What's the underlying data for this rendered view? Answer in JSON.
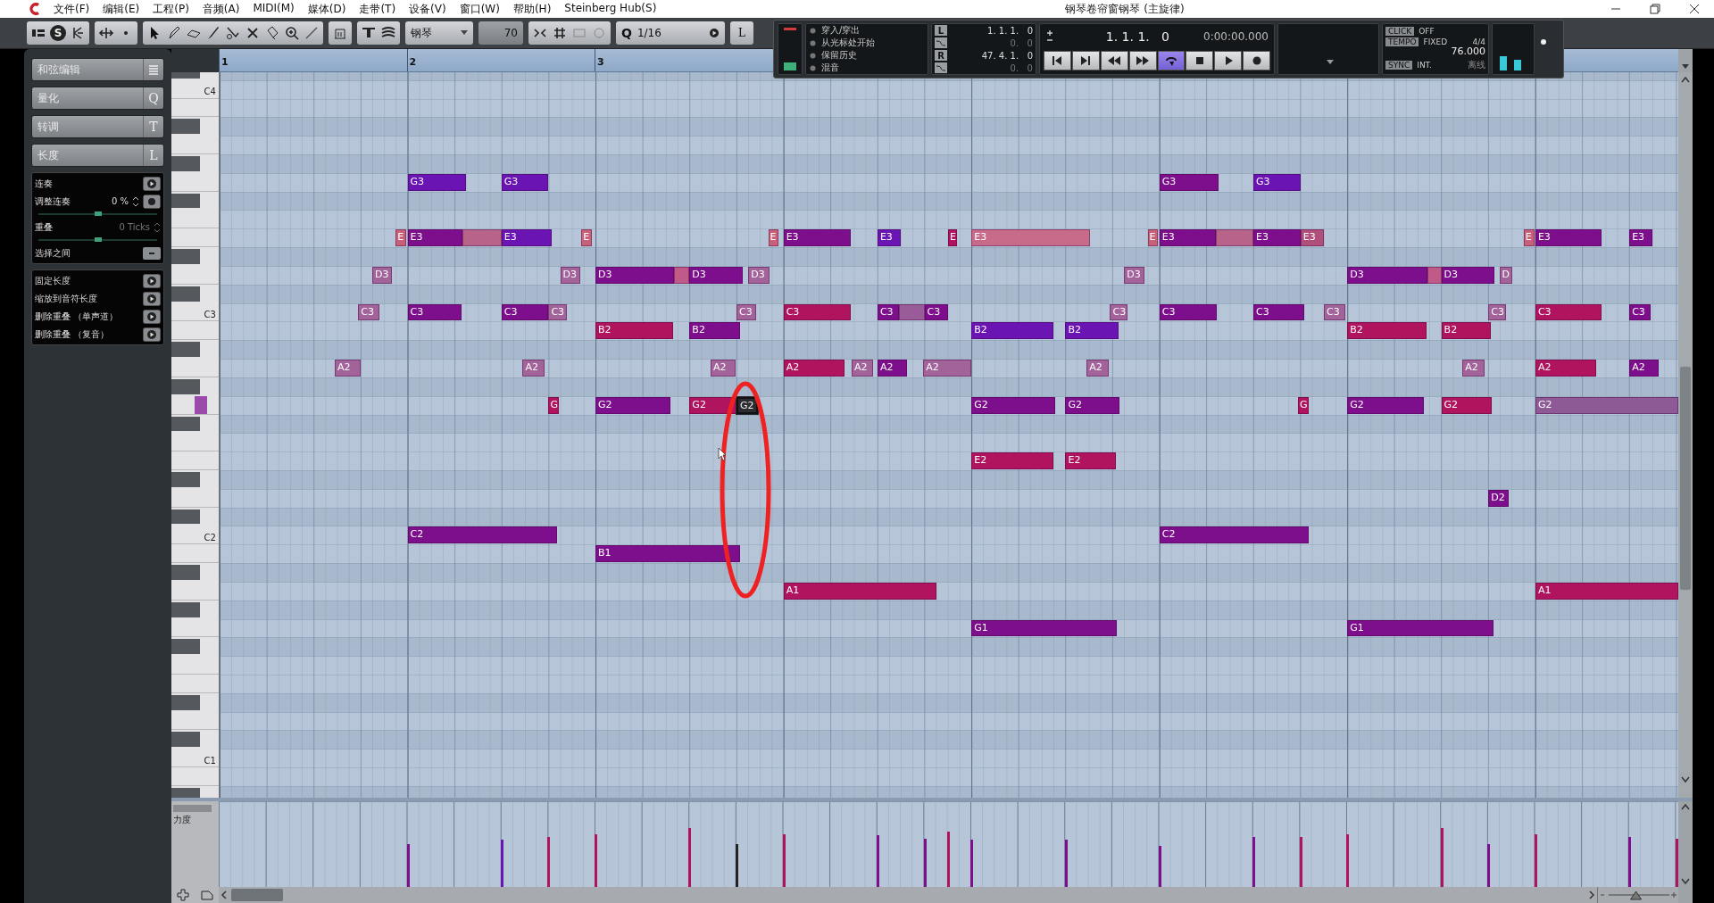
{
  "window": {
    "title": "钢琴卷帘窗钢琴 (主旋律)"
  },
  "menu": [
    "文件(F)",
    "编辑(E)",
    "工程(P)",
    "音频(A)",
    "MIDI(M)",
    "媒体(D)",
    "走带(T)",
    "设备(V)",
    "窗口(W)",
    "帮助(H)",
    "Steinberg Hub(S)"
  ],
  "toolbar": {
    "solo": "S",
    "instrument": "钢琴",
    "velocity": "70",
    "quantize_label": "Q",
    "quantize": "1/16",
    "length": "L"
  },
  "transport": {
    "modes": [
      {
        "label": "穿入/穿出"
      },
      {
        "label": "从光标处开始"
      },
      {
        "label": "保留历史"
      },
      {
        "label": "混音"
      }
    ],
    "locators": [
      {
        "label": "L",
        "value": "1. 1. 1.   0"
      },
      {
        "value": "0.   0"
      },
      {
        "label": "R",
        "value": "47. 4. 1.   0"
      },
      {
        "value": "0.   0"
      }
    ],
    "position": "1. 1. 1.   0",
    "time": "0:00:00.000",
    "buttons": [
      {
        "kind": "start",
        "on": false
      },
      {
        "kind": "end",
        "on": false
      },
      {
        "kind": "rewind",
        "on": false
      },
      {
        "kind": "forward",
        "on": false
      },
      {
        "kind": "cycle",
        "on": true
      },
      {
        "kind": "stop",
        "on": false
      },
      {
        "kind": "play",
        "on": false
      },
      {
        "kind": "record",
        "on": false
      }
    ],
    "click": {
      "label": "CLICK",
      "value": "OFF"
    },
    "tempo": {
      "label": "TEMPO",
      "mode": "FIXED",
      "signature": "4/4",
      "value": "76.000"
    },
    "sync": {
      "label": "SYNC",
      "value": "INT.",
      "status": "离线"
    }
  },
  "inspector": {
    "sections": [
      {
        "label": "和弦编辑"
      },
      {
        "label": "量化",
        "key": "Q"
      },
      {
        "label": "转调",
        "key": "T"
      },
      {
        "label": "长度",
        "key": "L"
      }
    ],
    "length_tools": [
      {
        "kind": "action",
        "label": "连奏"
      },
      {
        "kind": "value",
        "label": "调整连奏",
        "value": "0 %",
        "disabled": false,
        "level": 0.5
      },
      {
        "kind": "value",
        "label": "重叠",
        "value": "0 Ticks",
        "disabled": true,
        "level": 0.5
      },
      {
        "kind": "toggle",
        "label": "选择之间"
      }
    ],
    "actions": [
      {
        "label": "固定长度"
      },
      {
        "label": "缩放到音符长度"
      },
      {
        "label": "删除重叠 （单声道）"
      },
      {
        "label": "删除重叠 （复音）"
      }
    ]
  },
  "ruler": [
    "1",
    "2",
    "3"
  ],
  "keyboard": [
    "C4",
    "C3",
    "C2",
    "C1"
  ],
  "notes": [
    {
      "label": "G3",
      "color": "#6a14b4",
      "selected": false
    },
    {
      "label": "G3",
      "color": "#6a14b4",
      "selected": false
    },
    {
      "label": "G3",
      "color": "#7d0f8c",
      "selected": false
    },
    {
      "label": "G3",
      "color": "#6a14b4",
      "selected": false
    },
    {
      "label": "E",
      "color": "#c8607a",
      "selected": false
    },
    {
      "label": "E3",
      "color": "#7d0f8c",
      "selected": false
    },
    {
      "color": "#b8648a",
      "selected": false
    },
    {
      "label": "E3",
      "color": "#6a14b4",
      "selected": false
    },
    {
      "label": "E",
      "color": "#c8607a",
      "selected": false
    },
    {
      "label": "E",
      "color": "#c8607a",
      "selected": false
    },
    {
      "label": "E3",
      "color": "#7d0f8c",
      "selected": false
    },
    {
      "label": "E3",
      "color": "#6a14b4",
      "selected": false
    },
    {
      "label": "E",
      "color": "#b0145e",
      "selected": false
    },
    {
      "label": "E3",
      "color": "#c86a8a",
      "selected": false
    },
    {
      "label": "E",
      "color": "#c8607a",
      "selected": false
    },
    {
      "label": "E3",
      "color": "#7d0f8c",
      "selected": false
    },
    {
      "color": "#b8648a",
      "selected": false
    },
    {
      "label": "E3",
      "color": "#7d0f8c",
      "selected": false
    },
    {
      "label": "E3",
      "color": "#b0507a",
      "selected": false
    },
    {
      "label": "E",
      "color": "#c8607a",
      "selected": false
    },
    {
      "label": "E3",
      "color": "#7d0f8c",
      "selected": false
    },
    {
      "label": "E3",
      "color": "#7d0f8c",
      "selected": false
    },
    {
      "label": "D3",
      "color": "#a2629a",
      "selected": false
    },
    {
      "label": "D3",
      "color": "#a2629a",
      "selected": false
    },
    {
      "label": "D3",
      "color": "#7d0f8c",
      "selected": false
    },
    {
      "color": "#c05a88",
      "selected": false
    },
    {
      "label": "D3",
      "color": "#7d0f8c",
      "selected": false
    },
    {
      "label": "D3",
      "color": "#a2629a",
      "selected": false
    },
    {
      "label": "D3",
      "color": "#a2629a",
      "selected": false
    },
    {
      "label": "D3",
      "color": "#7d0f8c",
      "selected": false
    },
    {
      "color": "#c05a88",
      "selected": false
    },
    {
      "label": "D3",
      "color": "#7d0f8c",
      "selected": false
    },
    {
      "label": "D",
      "color": "#a2629a",
      "selected": false
    },
    {
      "label": "C3",
      "color": "#a2629a",
      "selected": false
    },
    {
      "label": "C3",
      "color": "#7d0f8c",
      "selected": false
    },
    {
      "label": "C3",
      "color": "#7d0f8c",
      "selected": false
    },
    {
      "label": "C3",
      "color": "#a2629a",
      "selected": false
    },
    {
      "label": "C3",
      "color": "#a2629a",
      "selected": false
    },
    {
      "label": "C3",
      "color": "#b0145e",
      "selected": false
    },
    {
      "label": "C3",
      "color": "#7d0f8c",
      "selected": false
    },
    {
      "color": "#9a5c98",
      "selected": false
    },
    {
      "label": "C3",
      "color": "#7d0f8c",
      "selected": false
    },
    {
      "label": "C3",
      "color": "#a2629a",
      "selected": false
    },
    {
      "label": "C3",
      "color": "#7d0f8c",
      "selected": false
    },
    {
      "label": "C3",
      "color": "#7d0f8c",
      "selected": false
    },
    {
      "label": "C3",
      "color": "#a2629a",
      "selected": false
    },
    {
      "label": "C3",
      "color": "#a2629a",
      "selected": false
    },
    {
      "label": "C3",
      "color": "#b0145e",
      "selected": false
    },
    {
      "label": "C3",
      "color": "#7d0f8c",
      "selected": false
    },
    {
      "label": "B2",
      "color": "#b0145e",
      "selected": false
    },
    {
      "label": "B2",
      "color": "#7d0f8c",
      "selected": false
    },
    {
      "label": "B2",
      "color": "#6a14b4",
      "selected": false
    },
    {
      "label": "B2",
      "color": "#6a14b4",
      "selected": false
    },
    {
      "label": "B2",
      "color": "#b0145e",
      "selected": false
    },
    {
      "label": "B2",
      "color": "#b0145e",
      "selected": false
    },
    {
      "label": "A2",
      "color": "#a2629a",
      "selected": false
    },
    {
      "label": "A2",
      "color": "#a2629a",
      "selected": false
    },
    {
      "label": "A2",
      "color": "#a2629a",
      "selected": false
    },
    {
      "label": "A2",
      "color": "#b0145e",
      "selected": false
    },
    {
      "label": "A2",
      "color": "#a2629a",
      "selected": false
    },
    {
      "label": "A2",
      "color": "#7d0f8c",
      "selected": false
    },
    {
      "label": "A2",
      "color": "#a2629a",
      "selected": false
    },
    {
      "label": "A2",
      "color": "#a2629a",
      "selected": false
    },
    {
      "label": "A2",
      "color": "#a2629a",
      "selected": false
    },
    {
      "label": "A2",
      "color": "#b0145e",
      "selected": false
    },
    {
      "label": "A2",
      "color": "#7d0f8c",
      "selected": false
    },
    {
      "label": "G",
      "color": "#b0145e",
      "selected": false
    },
    {
      "label": "G2",
      "color": "#7d0f8c",
      "selected": false
    },
    {
      "label": "G2",
      "color": "#b0145e",
      "selected": false
    },
    {
      "label": "G2",
      "color": "#2c2c30",
      "selected": true
    },
    {
      "label": "G2",
      "color": "#7d0f8c",
      "selected": false
    },
    {
      "label": "G2",
      "color": "#7d0f8c",
      "selected": false
    },
    {
      "label": "G",
      "color": "#b0145e",
      "selected": false
    },
    {
      "label": "G2",
      "color": "#7d0f8c",
      "selected": false
    },
    {
      "label": "G2",
      "color": "#b0145e",
      "selected": false
    },
    {
      "label": "G2",
      "color": "#8e5a96",
      "selected": false
    },
    {
      "label": "E2",
      "color": "#b0145e",
      "selected": false
    },
    {
      "label": "E2",
      "color": "#b0145e",
      "selected": false
    },
    {
      "label": "D2",
      "color": "#7d0f8c",
      "selected": false
    },
    {
      "label": "C2",
      "color": "#7d0f8c",
      "selected": false
    },
    {
      "label": "C2",
      "color": "#7d0f8c",
      "selected": false
    },
    {
      "label": "B1",
      "color": "#7d0f8c",
      "selected": false
    },
    {
      "label": "A1",
      "color": "#b0145e",
      "selected": false
    },
    {
      "label": "A1",
      "color": "#b0145e",
      "selected": false
    },
    {
      "label": "G1",
      "color": "#7d0f8c",
      "selected": false
    },
    {
      "label": "G1",
      "color": "#7d0f8c",
      "selected": false
    }
  ],
  "velocity_lane": {
    "label": "力度"
  },
  "zoom_slider": {
    "level": 0.45
  }
}
